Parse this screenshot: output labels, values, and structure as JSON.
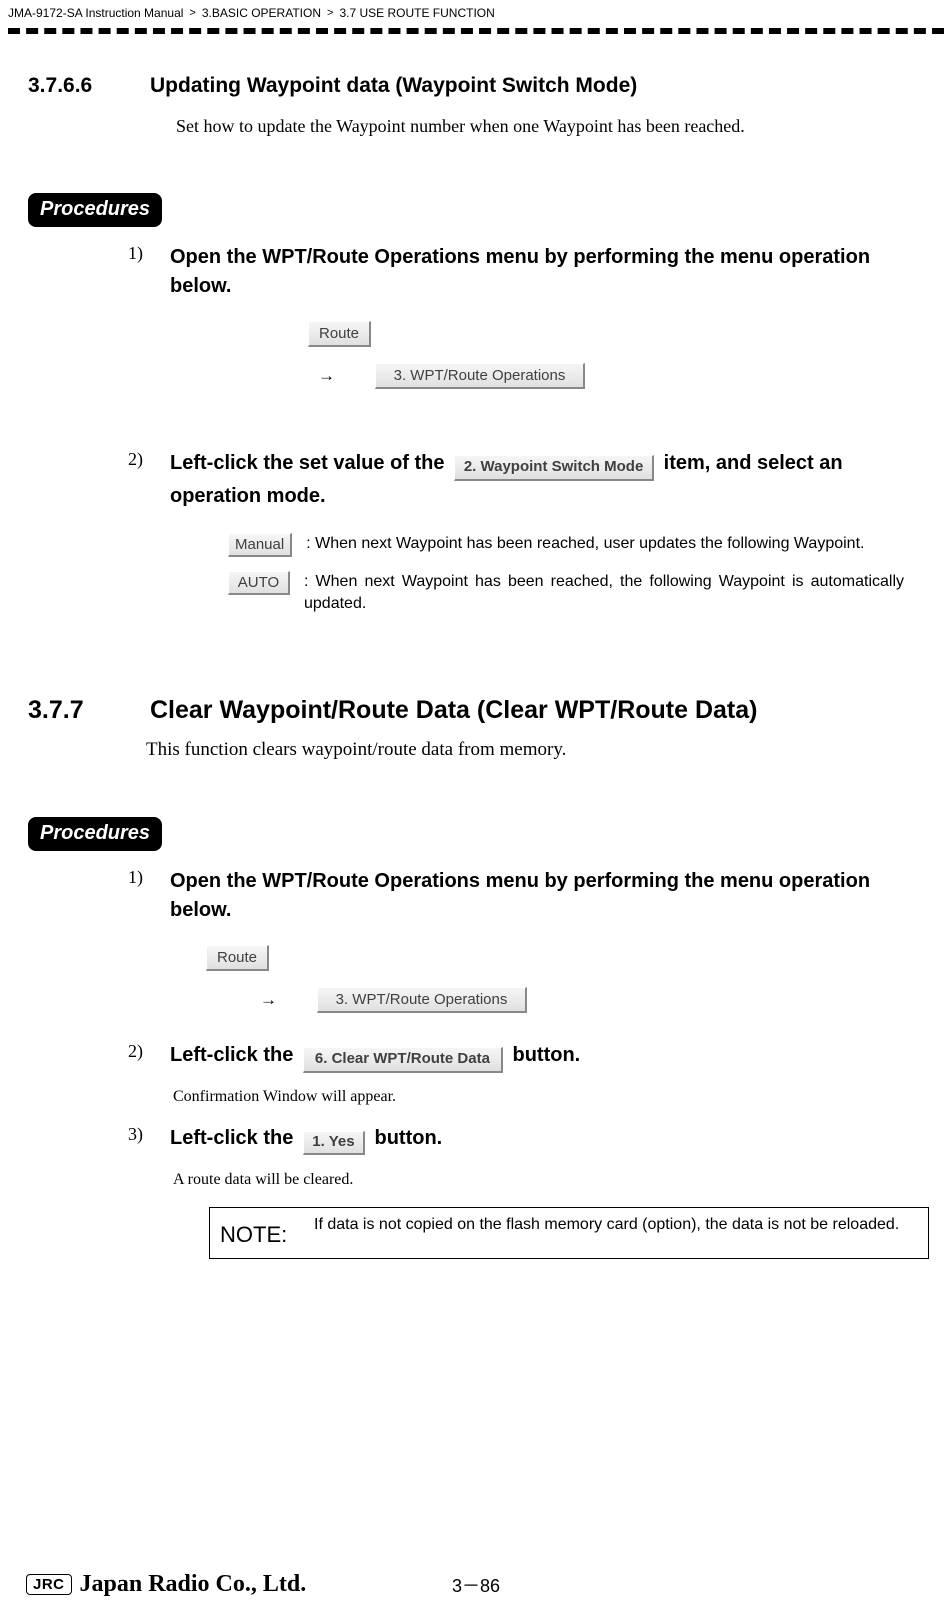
{
  "header": {
    "crumb1": "JMA-9172-SA Instruction Manual",
    "crumb2": "3.BASIC OPERATION",
    "crumb3": "3.7  USE ROUTE FUNCTION",
    "gt": ">"
  },
  "sec1": {
    "num": "3.7.6.6",
    "title": "Updating Waypoint data (Waypoint Switch Mode)",
    "intro": "Set how to update the Waypoint number when one Waypoint has been reached."
  },
  "proc_label": "Procedures",
  "step1": {
    "num": "1)",
    "text": "Open the WPT/Route Operations menu by performing the menu operation below."
  },
  "buttons": {
    "route": "Route",
    "wpt_ops": "3. WPT/Route Operations",
    "switch_mode": "2. Waypoint Switch Mode",
    "manual": "Manual",
    "auto": "AUTO",
    "clear_data": "6. Clear WPT/Route Data",
    "yes": "1. Yes"
  },
  "arrow": "→",
  "step2": {
    "num": "2)",
    "pre": "Left-click the set value of the ",
    "post": " item, and select an operation mode."
  },
  "opt_manual": ": When next Waypoint has been reached, user updates the following Waypoint.",
  "opt_auto": ": When next Waypoint has been reached, the following Waypoint is automatically updated.",
  "sec2": {
    "num": "3.7.7",
    "title": "Clear Waypoint/Route Data (Clear WPT/Route Data)",
    "intro": "This function clears waypoint/route data from memory."
  },
  "sec2_step2": {
    "num": "2)",
    "pre": "Left-click the ",
    "post": " button."
  },
  "confirm_text": "Confirmation Window will appear.",
  "sec2_step3": {
    "num": "3)",
    "pre": "Left-click the ",
    "post": " button."
  },
  "cleared_text": "A route data will be cleared.",
  "note": {
    "label": "NOTE:",
    "text": "If data is not copied on the flash memory card (option), the data is not be reloaded."
  },
  "footer": {
    "jrc": "JRC",
    "company": "Japan Radio Co., Ltd.",
    "page": "3－86"
  }
}
